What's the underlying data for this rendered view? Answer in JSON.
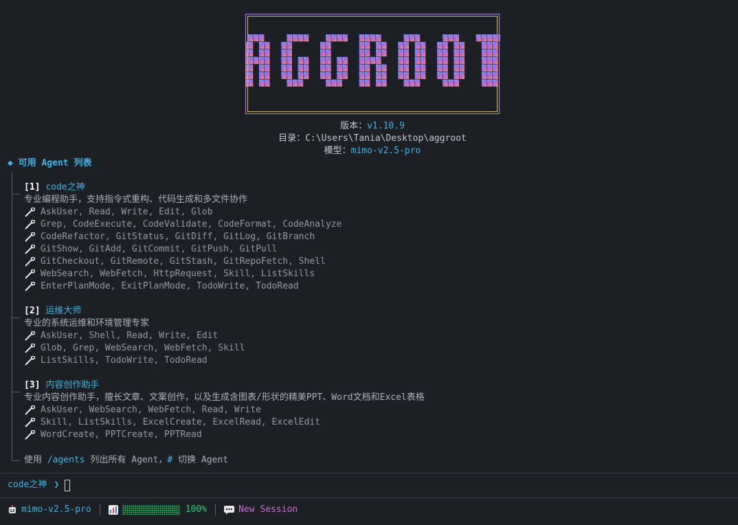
{
  "logo": {
    "text": "AGGROOT"
  },
  "header": {
    "version_label": "版本：",
    "version_value": "v1.10.9",
    "dir_label": "目录：",
    "dir_value": "C:\\Users\\Tania\\Desktop\\aggroot",
    "model_label": "模型：",
    "model_value": "mimo-v2.5-pro"
  },
  "section_title": "◆ 可用 Agent 列表",
  "agents": [
    {
      "index": "[1]",
      "name": "code之神",
      "description": "专业编程助手，支持指令式重构、代码生成和多文件协作",
      "tool_lines": [
        "AskUser, Read, Write, Edit, Glob",
        "Grep, CodeExecute, CodeValidate, CodeFormat, CodeAnalyze",
        "CodeRefactor, GitStatus, GitDiff, GitLog, GitBranch",
        "GitShow, GitAdd, GitCommit, GitPush, GitPull",
        "GitCheckout, GitRemote, GitStash, GitRepoFetch, Shell",
        "WebSearch, WebFetch, HttpRequest, Skill, ListSkills",
        "EnterPlanMode, ExitPlanMode, TodoWrite, TodoRead"
      ]
    },
    {
      "index": "[2]",
      "name": "运维大师",
      "description": "专业的系统运维和环境管理专家",
      "tool_lines": [
        "AskUser, Shell, Read, Write, Edit",
        "Glob, Grep, WebSearch, WebFetch, Skill",
        "ListSkills, TodoWrite, TodoRead"
      ]
    },
    {
      "index": "[3]",
      "name": "内容创作助手",
      "description": "专业内容创作助手，擅长文章、文案创作，以及生成含图表/形状的精美PPT、Word文档和Excel表格",
      "tool_lines": [
        "AskUser, WebSearch, WebFetch, Read, Write",
        "Skill, ListSkills, ExcelCreate, ExcelRead, ExcelEdit",
        "WordCreate, PPTCreate, PPTRead"
      ]
    }
  ],
  "footer_hint": {
    "pre": "使用 ",
    "cmd": "/agents",
    "mid": " 列出所有 Agent，",
    "hash": "#",
    "post": " 切换 Agent"
  },
  "prompt": {
    "agent": "code之神",
    "arrow": "❯"
  },
  "status": {
    "model": "mimo-v2.5-pro",
    "context_percent": "100%",
    "context_fill": 1.0,
    "session": "New Session"
  },
  "colors": {
    "accent": "#3fb5e8",
    "green": "#2fd17f",
    "pink": "#d070d8",
    "bg": "#1c1f24"
  },
  "icons": {
    "tool": "wrench-icon",
    "model": "robot-icon",
    "context": "chart-icon",
    "session": "chat-icon"
  }
}
